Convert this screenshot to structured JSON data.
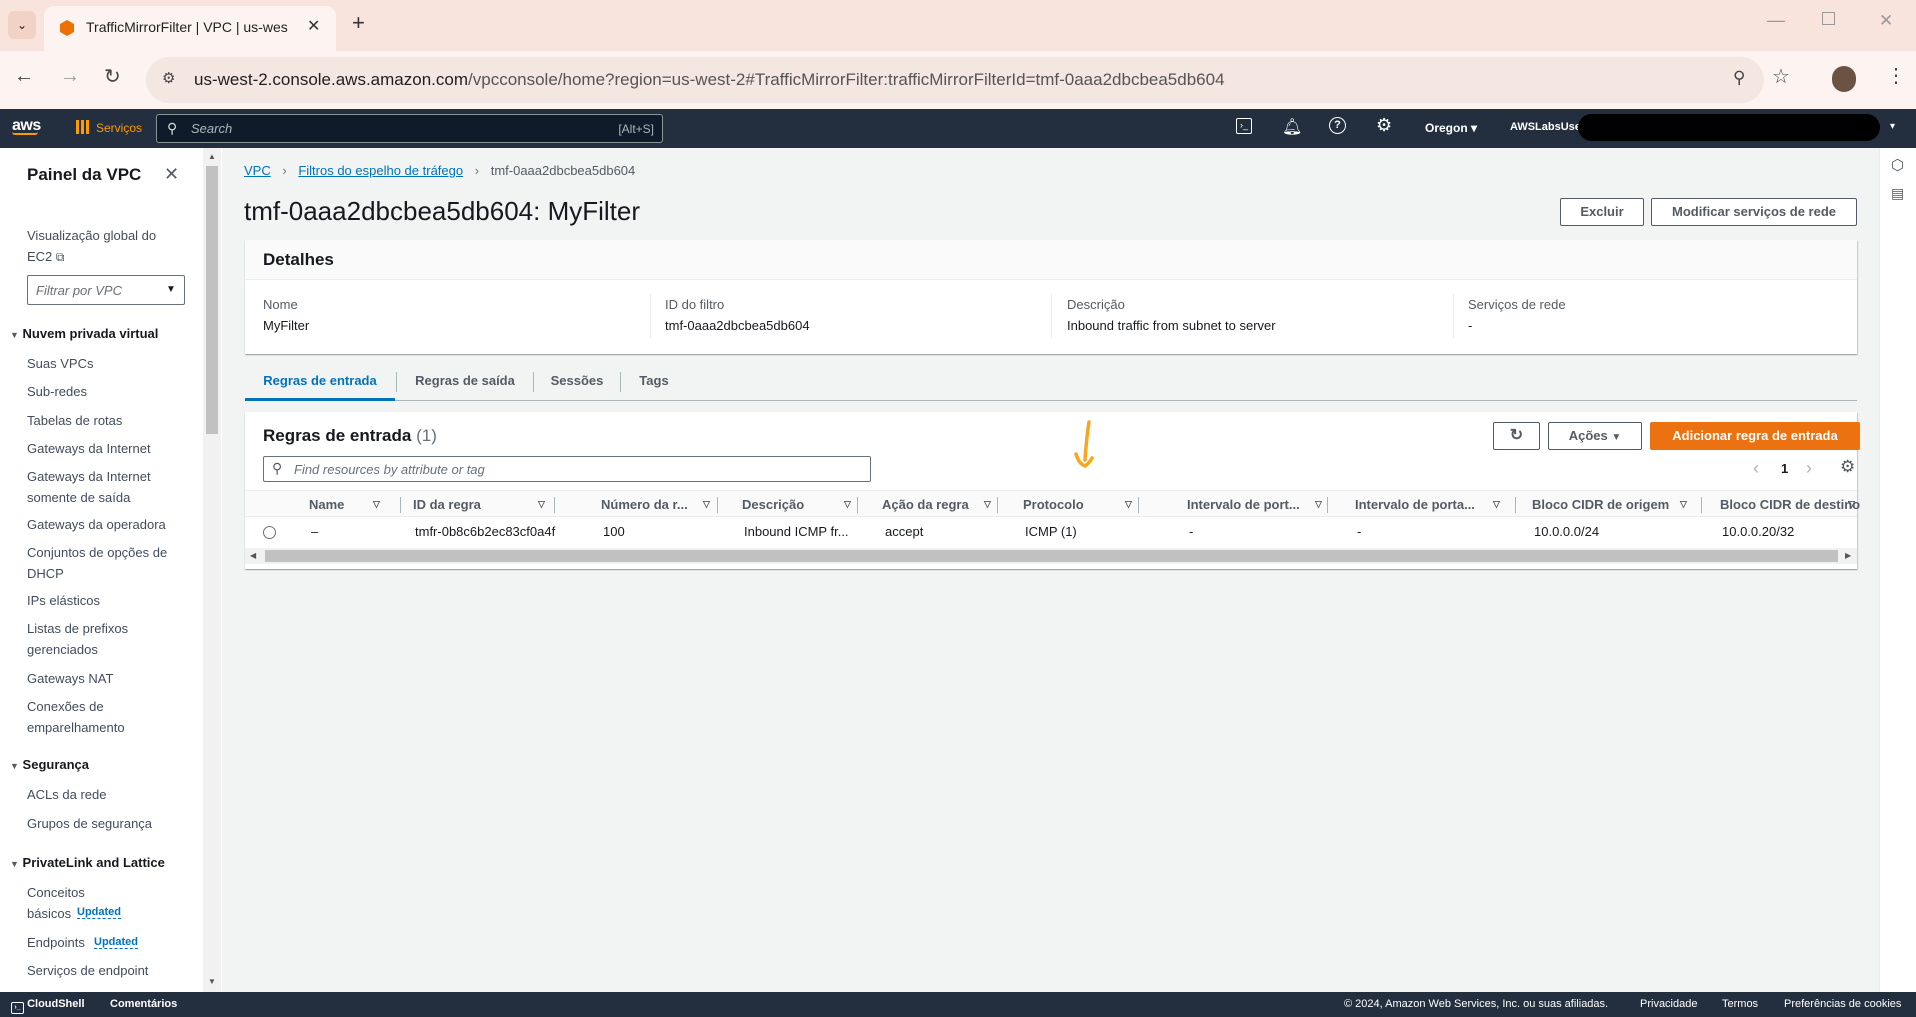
{
  "browser": {
    "tab_title": "TrafficMirrorFilter | VPC | us-wes",
    "url_domain": "us-west-2.console.aws.amazon.com",
    "url_path": "/vpcconsole/home?region=us-west-2#TrafficMirrorFilter:trafficMirrorFilterId=tmf-0aaa2dbcbea5db604"
  },
  "awsnav": {
    "services": "Serviços",
    "search_placeholder": "Search",
    "search_shortcut": "[Alt+S]",
    "region": "Oregon",
    "account": "AWSLabsUse"
  },
  "sidebar": {
    "title": "Painel da VPC",
    "ec2_global_view": "Visualização global do EC2",
    "filter_placeholder": "Filtrar por VPC",
    "sections": [
      {
        "title": "Nuvem privada virtual"
      },
      {
        "title": "Segurança"
      },
      {
        "title": "PrivateLink and Lattice"
      }
    ],
    "items": [
      "Suas VPCs",
      "Sub-redes",
      "Tabelas de rotas",
      "Gateways da Internet",
      "Gateways da Internet somente de saída",
      "Gateways da operadora",
      "Conjuntos de opções de DHCP",
      "IPs elásticos",
      "Listas de prefixos gerenciados",
      "Gateways NAT",
      "Conexões de emparelhamento",
      "ACLs da rede",
      "Grupos de segurança",
      "Conceitos básicos",
      "Endpoints",
      "Serviços de endpoint"
    ],
    "updated_badge": "Updated"
  },
  "breadcrumb": {
    "root": "VPC",
    "parent": "Filtros do espelho de tráfego",
    "current": "tmf-0aaa2dbcbea5db604"
  },
  "page": {
    "title": "tmf-0aaa2dbcbea5db604: MyFilter",
    "delete_button": "Excluir",
    "modify_button": "Modificar serviços de rede"
  },
  "details": {
    "heading": "Detalhes",
    "fields": [
      {
        "label": "Nome",
        "value": "MyFilter"
      },
      {
        "label": "ID do filtro",
        "value": "tmf-0aaa2dbcbea5db604"
      },
      {
        "label": "Descrição",
        "value": "Inbound traffic from subnet to server"
      },
      {
        "label": "Serviços de rede",
        "value": "-"
      }
    ]
  },
  "tabs": [
    {
      "label": "Regras de entrada",
      "active": true
    },
    {
      "label": "Regras de saída"
    },
    {
      "label": "Sessões"
    },
    {
      "label": "Tags"
    }
  ],
  "rules": {
    "heading": "Regras de entrada",
    "count": "(1)",
    "actions_button": "Ações",
    "add_button": "Adicionar regra de entrada",
    "search_placeholder": "Find resources by attribute or tag",
    "page_number": "1",
    "columns": [
      "Name",
      "ID da regra",
      "Número da r...",
      "Descrição",
      "Ação da regra",
      "Protocolo",
      "Intervalo de port...",
      "Intervalo de porta...",
      "Bloco CIDR de origem",
      "Bloco CIDR de destino"
    ],
    "rows": [
      [
        "–",
        "tmfr-0b8c6b2ec83cf0a4f",
        "100",
        "Inbound ICMP fr...",
        "accept",
        "ICMP (1)",
        "-",
        "-",
        "10.0.0.0/24",
        "10.0.0.20/32"
      ]
    ]
  },
  "footer": {
    "cloudshell": "CloudShell",
    "feedback": "Comentários",
    "copyright": "© 2024, Amazon Web Services, Inc. ou suas afiliadas.",
    "privacy": "Privacidade",
    "terms": "Termos",
    "cookies": "Preferências de cookies"
  },
  "colors": {
    "aws_nav": "#232f3e",
    "primary_orange": "#ec7211",
    "link_blue": "#0073bb",
    "annotation": "#f5a623"
  }
}
